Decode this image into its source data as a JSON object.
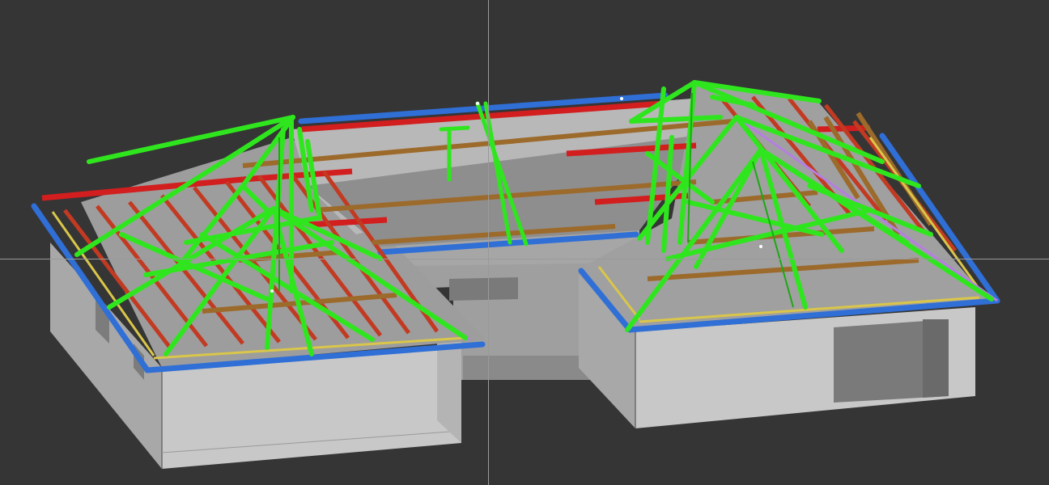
{
  "viewport": {
    "background": "#353535",
    "cursor": "crosshair"
  },
  "colors": {
    "wall_front": "#c9c9c9",
    "wall_side": "#a9a9a9",
    "wall_dark": "#8f8f8f",
    "slab": "#9b9b9b",
    "opening": "#6e6e6e",
    "truss": "#2fe61e",
    "truss_dark": "#1aa912",
    "rafter": "#d21e1e",
    "purlin": "#9c6a2b",
    "fascia": "#2f6fd6",
    "ridge": "#b47fe0",
    "plate": "#d9c64a"
  },
  "model": {
    "description_icon": "3d-roof-truss-model-icon"
  }
}
